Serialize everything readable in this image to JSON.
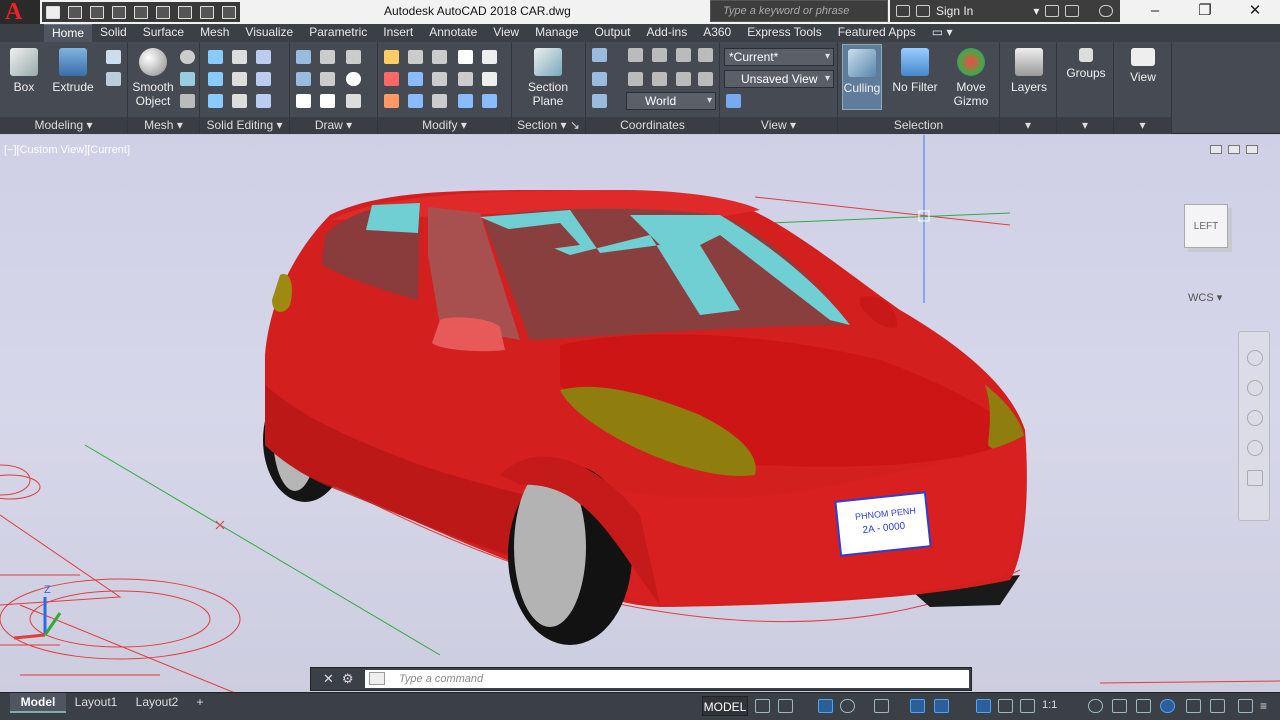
{
  "app": {
    "logo_letter": "A",
    "title": "Autodesk AutoCAD 2018    CAR.dwg",
    "search_placeholder": "Type a keyword or phrase",
    "sign_in": "Sign In"
  },
  "ribbon": {
    "tabs": [
      "Home",
      "Solid",
      "Surface",
      "Mesh",
      "Visualize",
      "Parametric",
      "Insert",
      "Annotate",
      "View",
      "Manage",
      "Output",
      "Add-ins",
      "A360",
      "Express Tools",
      "Featured Apps"
    ],
    "active_tab": "Home",
    "panels": {
      "modeling": {
        "title": "Modeling",
        "box": "Box",
        "extrude": "Extrude"
      },
      "mesh": {
        "title": "Mesh",
        "smooth_object_line1": "Smooth",
        "smooth_object_line2": "Object"
      },
      "solid_editing": {
        "title": "Solid Editing"
      },
      "draw": {
        "title": "Draw"
      },
      "modify": {
        "title": "Modify"
      },
      "section": {
        "title": "Section",
        "section_plane_line1": "Section",
        "section_plane_line2": "Plane"
      },
      "coordinates": {
        "title": "Coordinates",
        "ucs_value": "World"
      },
      "view": {
        "title": "View",
        "visual_style": "*Current*",
        "saved_view": "Unsaved View"
      },
      "selection": {
        "title": "Selection",
        "culling": "Culling",
        "no_filter": "No Filter",
        "move_gizmo_line1": "Move",
        "move_gizmo_line2": "Gizmo"
      },
      "layers": {
        "label": "Layers"
      },
      "groups": {
        "label": "Groups"
      },
      "view_big": {
        "label": "View"
      }
    }
  },
  "viewport": {
    "view_label": "[−][Custom View][Current]",
    "viewcube_face": "LEFT",
    "wcs": "WCS",
    "plate_line1": "PHNOM PENH",
    "plate_line2": "2A - 0000",
    "axis_z": "Z"
  },
  "command": {
    "placeholder": "Type a command"
  },
  "status": {
    "layout_tabs": [
      "Model",
      "Layout1",
      "Layout2"
    ],
    "active_layout": "Model",
    "add_tab": "+",
    "model_button": "MODEL",
    "scale": "1:1"
  },
  "colors": {
    "car_body": "#d91f1f",
    "glass": "#6fcfd3",
    "headlight": "#8a7a10",
    "tire": "#111111",
    "rim": "#b3b3b3",
    "ribbon_bg": "#464b53",
    "viewport_bg": "#cfd0e6"
  }
}
